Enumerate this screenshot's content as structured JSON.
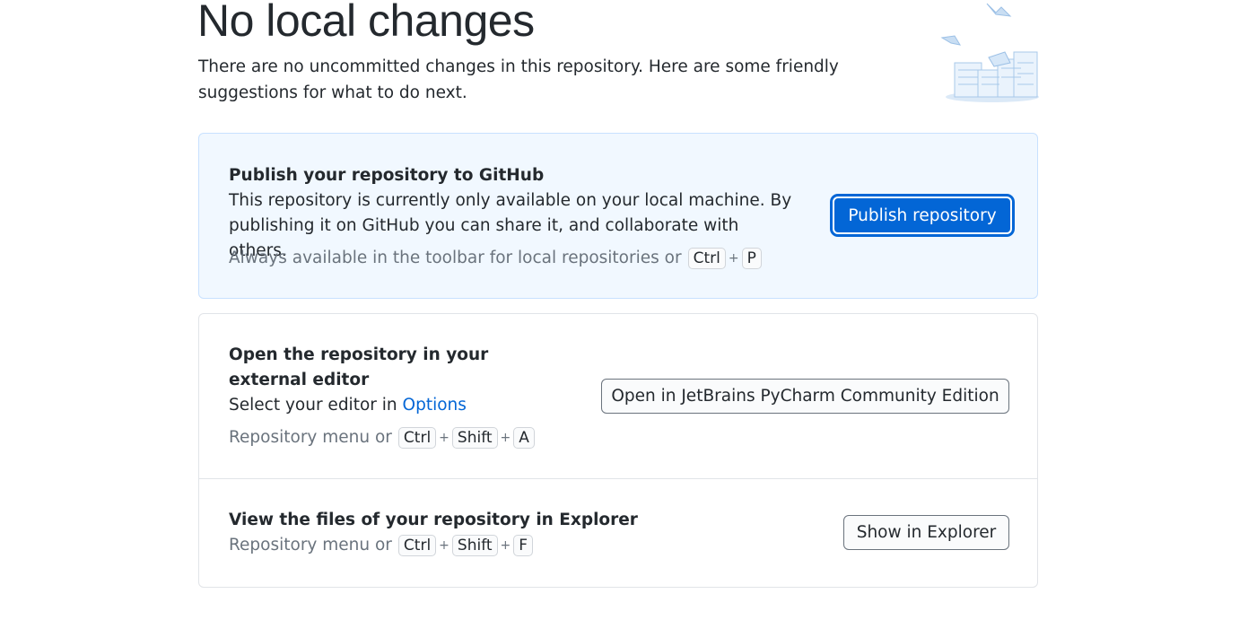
{
  "header": {
    "title": "No local changes",
    "description": "There are no uncommitted changes in this repository. Here are some friendly suggestions for what to do next."
  },
  "publish": {
    "title": "Publish your repository to GitHub",
    "description": "This repository is currently only available on your local machine. By publishing it on GitHub you can share it, and collaborate with others.",
    "hint_prefix": "Always available in the toolbar for local repositories or",
    "shortcut": [
      "Ctrl",
      "P"
    ],
    "button_label": "Publish repository"
  },
  "editor": {
    "title": "Open the repository in your external editor",
    "description_prefix": "Select your editor in",
    "options_link": "Options",
    "hint_prefix": "Repository menu or",
    "shortcut": [
      "Ctrl",
      "Shift",
      "A"
    ],
    "button_label": "Open in JetBrains PyCharm Community Edition"
  },
  "explorer": {
    "title": "View the files of your repository in Explorer",
    "hint_prefix": "Repository menu or",
    "shortcut": [
      "Ctrl",
      "Shift",
      "F"
    ],
    "button_label": "Show in Explorer"
  },
  "shortcut_separator": "+",
  "colors": {
    "accent": "#0366d6",
    "publish_card_bg": "#f1f8ff",
    "hint_text": "#6a737d"
  }
}
